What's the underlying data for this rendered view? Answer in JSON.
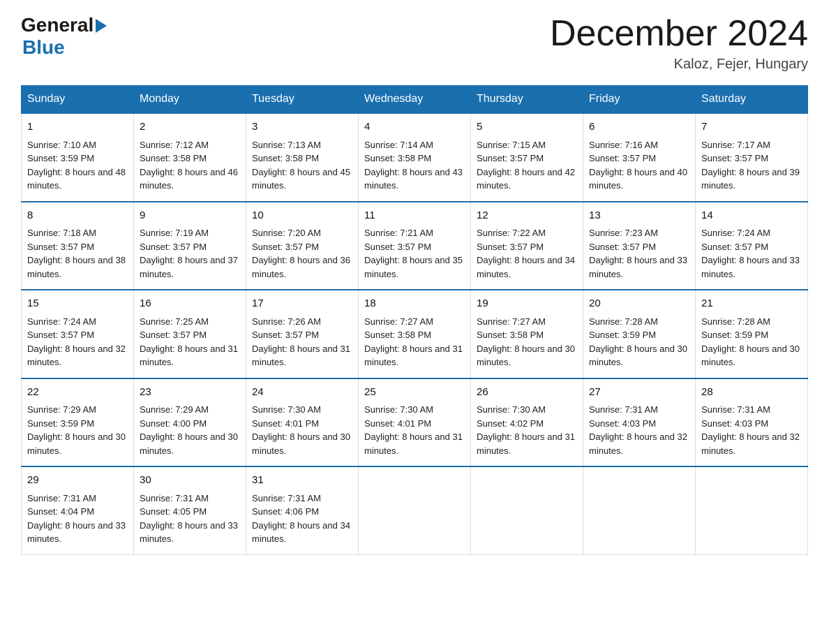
{
  "logo": {
    "general": "General",
    "blue": "Blue"
  },
  "title": "December 2024",
  "location": "Kaloz, Fejer, Hungary",
  "days_of_week": [
    "Sunday",
    "Monday",
    "Tuesday",
    "Wednesday",
    "Thursday",
    "Friday",
    "Saturday"
  ],
  "weeks": [
    [
      {
        "day": "1",
        "sunrise": "7:10 AM",
        "sunset": "3:59 PM",
        "daylight": "8 hours and 48 minutes."
      },
      {
        "day": "2",
        "sunrise": "7:12 AM",
        "sunset": "3:58 PM",
        "daylight": "8 hours and 46 minutes."
      },
      {
        "day": "3",
        "sunrise": "7:13 AM",
        "sunset": "3:58 PM",
        "daylight": "8 hours and 45 minutes."
      },
      {
        "day": "4",
        "sunrise": "7:14 AM",
        "sunset": "3:58 PM",
        "daylight": "8 hours and 43 minutes."
      },
      {
        "day": "5",
        "sunrise": "7:15 AM",
        "sunset": "3:57 PM",
        "daylight": "8 hours and 42 minutes."
      },
      {
        "day": "6",
        "sunrise": "7:16 AM",
        "sunset": "3:57 PM",
        "daylight": "8 hours and 40 minutes."
      },
      {
        "day": "7",
        "sunrise": "7:17 AM",
        "sunset": "3:57 PM",
        "daylight": "8 hours and 39 minutes."
      }
    ],
    [
      {
        "day": "8",
        "sunrise": "7:18 AM",
        "sunset": "3:57 PM",
        "daylight": "8 hours and 38 minutes."
      },
      {
        "day": "9",
        "sunrise": "7:19 AM",
        "sunset": "3:57 PM",
        "daylight": "8 hours and 37 minutes."
      },
      {
        "day": "10",
        "sunrise": "7:20 AM",
        "sunset": "3:57 PM",
        "daylight": "8 hours and 36 minutes."
      },
      {
        "day": "11",
        "sunrise": "7:21 AM",
        "sunset": "3:57 PM",
        "daylight": "8 hours and 35 minutes."
      },
      {
        "day": "12",
        "sunrise": "7:22 AM",
        "sunset": "3:57 PM",
        "daylight": "8 hours and 34 minutes."
      },
      {
        "day": "13",
        "sunrise": "7:23 AM",
        "sunset": "3:57 PM",
        "daylight": "8 hours and 33 minutes."
      },
      {
        "day": "14",
        "sunrise": "7:24 AM",
        "sunset": "3:57 PM",
        "daylight": "8 hours and 33 minutes."
      }
    ],
    [
      {
        "day": "15",
        "sunrise": "7:24 AM",
        "sunset": "3:57 PM",
        "daylight": "8 hours and 32 minutes."
      },
      {
        "day": "16",
        "sunrise": "7:25 AM",
        "sunset": "3:57 PM",
        "daylight": "8 hours and 31 minutes."
      },
      {
        "day": "17",
        "sunrise": "7:26 AM",
        "sunset": "3:57 PM",
        "daylight": "8 hours and 31 minutes."
      },
      {
        "day": "18",
        "sunrise": "7:27 AM",
        "sunset": "3:58 PM",
        "daylight": "8 hours and 31 minutes."
      },
      {
        "day": "19",
        "sunrise": "7:27 AM",
        "sunset": "3:58 PM",
        "daylight": "8 hours and 30 minutes."
      },
      {
        "day": "20",
        "sunrise": "7:28 AM",
        "sunset": "3:59 PM",
        "daylight": "8 hours and 30 minutes."
      },
      {
        "day": "21",
        "sunrise": "7:28 AM",
        "sunset": "3:59 PM",
        "daylight": "8 hours and 30 minutes."
      }
    ],
    [
      {
        "day": "22",
        "sunrise": "7:29 AM",
        "sunset": "3:59 PM",
        "daylight": "8 hours and 30 minutes."
      },
      {
        "day": "23",
        "sunrise": "7:29 AM",
        "sunset": "4:00 PM",
        "daylight": "8 hours and 30 minutes."
      },
      {
        "day": "24",
        "sunrise": "7:30 AM",
        "sunset": "4:01 PM",
        "daylight": "8 hours and 30 minutes."
      },
      {
        "day": "25",
        "sunrise": "7:30 AM",
        "sunset": "4:01 PM",
        "daylight": "8 hours and 31 minutes."
      },
      {
        "day": "26",
        "sunrise": "7:30 AM",
        "sunset": "4:02 PM",
        "daylight": "8 hours and 31 minutes."
      },
      {
        "day": "27",
        "sunrise": "7:31 AM",
        "sunset": "4:03 PM",
        "daylight": "8 hours and 32 minutes."
      },
      {
        "day": "28",
        "sunrise": "7:31 AM",
        "sunset": "4:03 PM",
        "daylight": "8 hours and 32 minutes."
      }
    ],
    [
      {
        "day": "29",
        "sunrise": "7:31 AM",
        "sunset": "4:04 PM",
        "daylight": "8 hours and 33 minutes."
      },
      {
        "day": "30",
        "sunrise": "7:31 AM",
        "sunset": "4:05 PM",
        "daylight": "8 hours and 33 minutes."
      },
      {
        "day": "31",
        "sunrise": "7:31 AM",
        "sunset": "4:06 PM",
        "daylight": "8 hours and 34 minutes."
      },
      null,
      null,
      null,
      null
    ]
  ]
}
